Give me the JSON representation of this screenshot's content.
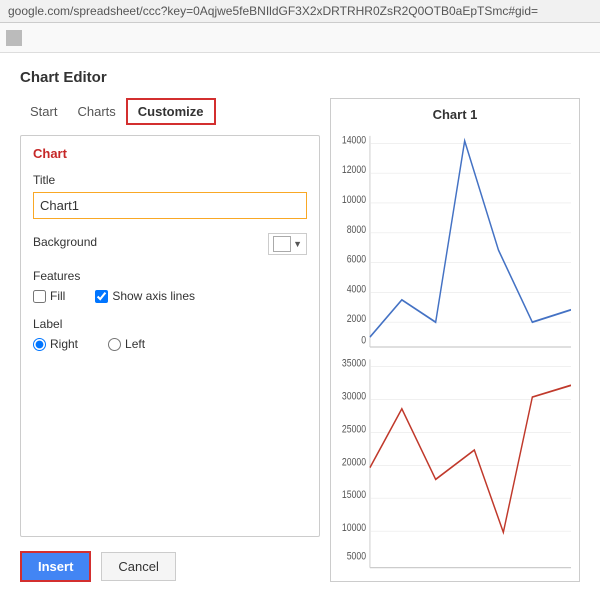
{
  "address_bar": {
    "url": "google.com/spreadsheet/ccc?key=0Aqjwe5feBNIldGF3X2xDRTRHR0ZsR2Q0OTB0aEpTSmc#gid="
  },
  "editor": {
    "title": "Chart Editor",
    "tabs": [
      {
        "id": "start",
        "label": "Start"
      },
      {
        "id": "charts",
        "label": "Charts"
      },
      {
        "id": "customize",
        "label": "Customize"
      }
    ],
    "active_tab": "customize",
    "section_header": "Chart",
    "fields": {
      "title_label": "Title",
      "title_value": "Chart1",
      "background_label": "Background"
    },
    "features": {
      "label": "Features",
      "fill_label": "Fill",
      "fill_checked": false,
      "show_axis_label": "Show axis lines",
      "show_axis_checked": true
    },
    "label_section": {
      "label": "Label",
      "right_label": "Right",
      "left_label": "Left",
      "selected": "right"
    }
  },
  "chart_preview": {
    "title": "Chart 1",
    "upper": {
      "y_labels": [
        "14000",
        "12000",
        "10000",
        "8000",
        "6000",
        "4000",
        "2000",
        "0"
      ],
      "color": "#4472c4"
    },
    "lower": {
      "y_labels": [
        "35000",
        "30000",
        "25000",
        "20000",
        "15000",
        "10000",
        "5000"
      ],
      "color": "#c0392b"
    }
  },
  "buttons": {
    "insert_label": "Insert",
    "cancel_label": "Cancel"
  }
}
